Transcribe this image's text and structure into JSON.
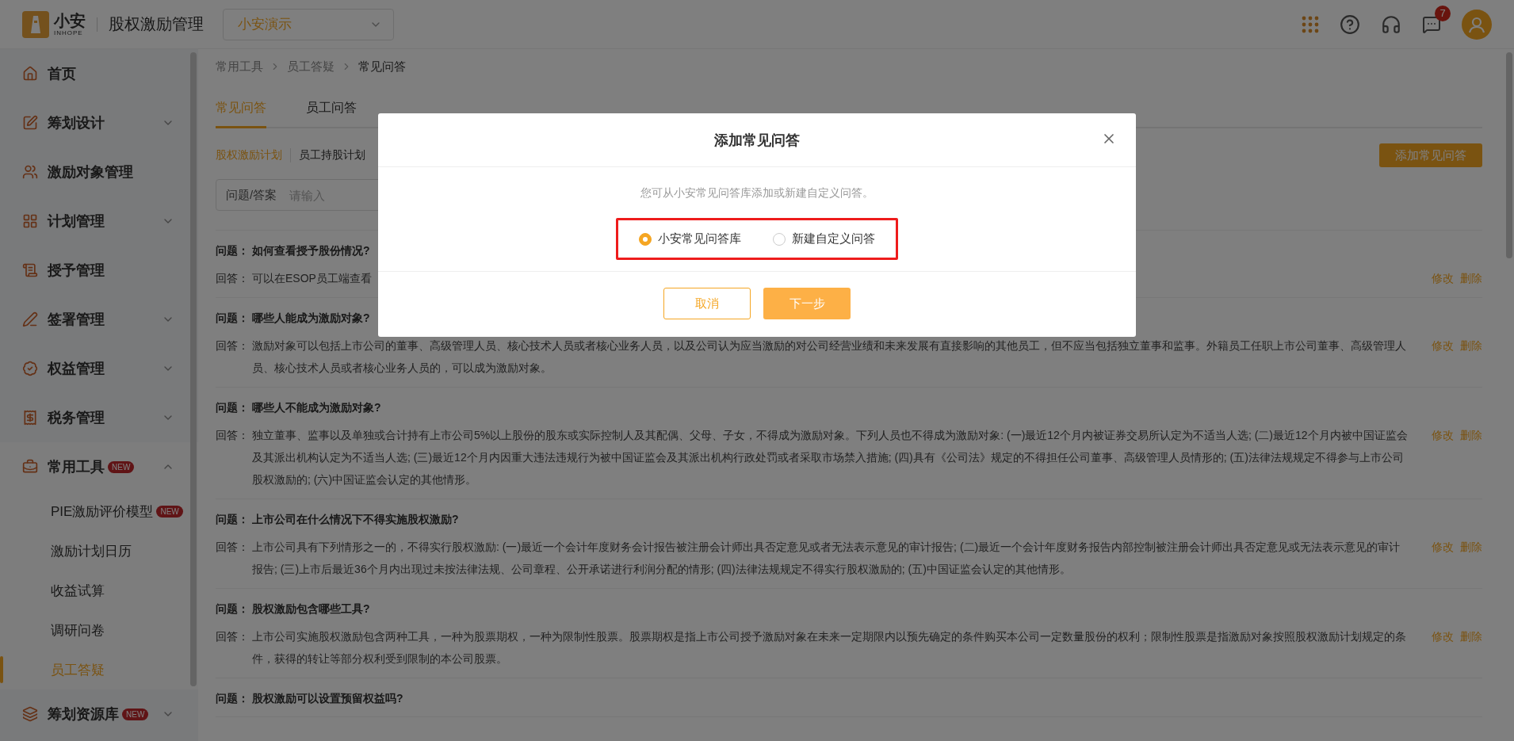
{
  "header": {
    "logo_name": "小安",
    "logo_sub": "INHOPE",
    "app_title": "股权激励管理",
    "org_select": "小安演示",
    "message_badge": "7"
  },
  "sidebar": {
    "items": [
      {
        "label": "首页",
        "selected": false
      },
      {
        "label": "筹划设计",
        "selected": false,
        "expanded": false
      },
      {
        "label": "激励对象管理",
        "selected": false
      },
      {
        "label": "计划管理",
        "selected": false,
        "expanded": false
      },
      {
        "label": "授予管理",
        "selected": false
      },
      {
        "label": "签署管理",
        "selected": false,
        "expanded": false
      },
      {
        "label": "权益管理",
        "selected": false,
        "expanded": false
      },
      {
        "label": "税务管理",
        "selected": false,
        "expanded": false
      },
      {
        "label": "常用工具",
        "badge": "NEW",
        "selected": false,
        "expanded": true,
        "children": [
          {
            "label": "PIE激励评价模型",
            "badge": "NEW",
            "selected": false
          },
          {
            "label": "激励计划日历",
            "selected": false
          },
          {
            "label": "收益试算",
            "selected": false
          },
          {
            "label": "调研问卷",
            "selected": false
          },
          {
            "label": "员工答疑",
            "selected": true
          }
        ]
      },
      {
        "label": "筹划资源库",
        "badge": "NEW",
        "selected": false,
        "expanded": false
      }
    ]
  },
  "breadcrumb": [
    "常用工具",
    "员工答疑",
    "常见问答"
  ],
  "tabs": [
    {
      "label": "常见问答",
      "selected": true
    },
    {
      "label": "员工问答",
      "selected": false
    }
  ],
  "subtabs": [
    {
      "label": "股权激励计划",
      "selected": true
    },
    {
      "label": "员工持股计划",
      "selected": false
    }
  ],
  "search": {
    "label": "问题/答案",
    "placeholder": "请输入"
  },
  "add_button": "添加常见问答",
  "faq": [
    {
      "question_label": "问题：",
      "question": "如何查看授予股份情况?",
      "answer_label": "回答：",
      "answer": "可以在ESOP员工端查看",
      "actions": [
        "修改",
        "删除"
      ]
    },
    {
      "question_label": "问题：",
      "question": "哪些人能成为激励对象?",
      "answer_label": "回答：",
      "answer": "激励对象可以包括上市公司的董事、高级管理人员、核心技术人员或者核心业务人员，以及公司认为应当激励的对公司经营业绩和未来发展有直接影响的其他员工，但不应当包括独立董事和监事。外籍员工任职上市公司董事、高级管理人员、核心技术人员或者核心业务人员的，可以成为激励对象。",
      "actions": [
        "修改",
        "删除"
      ]
    },
    {
      "question_label": "问题：",
      "question": "哪些人不能成为激励对象?",
      "answer_label": "回答：",
      "answer": "独立董事、监事以及单独或合计持有上市公司5%以上股份的股东或实际控制人及其配偶、父母、子女，不得成为激励对象。下列人员也不得成为激励对象: (一)最近12个月内被证券交易所认定为不适当人选; (二)最近12个月内被中国证监会及其派出机构认定为不适当人选; (三)最近12个月内因重大违法违规行为被中国证监会及其派出机构行政处罚或者采取市场禁入措施; (四)具有《公司法》规定的不得担任公司董事、高级管理人员情形的; (五)法律法规规定不得参与上市公司股权激励的; (六)中国证监会认定的其他情形。",
      "actions": [
        "修改",
        "删除"
      ]
    },
    {
      "question_label": "问题：",
      "question": "上市公司在什么情况下不得实施股权激励?",
      "answer_label": "回答：",
      "answer": "上市公司具有下列情形之一的，不得实行股权激励: (一)最近一个会计年度财务会计报告被注册会计师出具否定意见或者无法表示意见的审计报告; (二)最近一个会计年度财务报告内部控制被注册会计师出具否定意见或无法表示意见的审计报告; (三)上市后最近36个月内出现过未按法律法规、公司章程、公开承诺进行利润分配的情形; (四)法律法规规定不得实行股权激励的; (五)中国证监会认定的其他情形。",
      "actions": [
        "修改",
        "删除"
      ]
    },
    {
      "question_label": "问题：",
      "question": "股权激励包含哪些工具?",
      "answer_label": "回答：",
      "answer": "上市公司实施股权激励包含两种工具，一种为股票期权，一种为限制性股票。股票期权是指上市公司授予激励对象在未来一定期限内以预先确定的条件购买本公司一定数量股份的权利；限制性股票是指激励对象按照股权激励计划规定的条件，获得的转让等部分权利受到限制的本公司股票。",
      "actions": [
        "修改",
        "删除"
      ]
    },
    {
      "question_label": "问题：",
      "question": "股权激励可以设置预留权益吗?"
    }
  ],
  "modal": {
    "title": "添加常见问答",
    "hint": "您可从小安常见问答库添加或新建自定义问答。",
    "options_highlighted": true,
    "options": [
      {
        "label": "小安常见问答库",
        "selected": true
      },
      {
        "label": "新建自定义问答",
        "selected": false
      }
    ],
    "cancel_button": "取消",
    "next_button": "下一步"
  }
}
